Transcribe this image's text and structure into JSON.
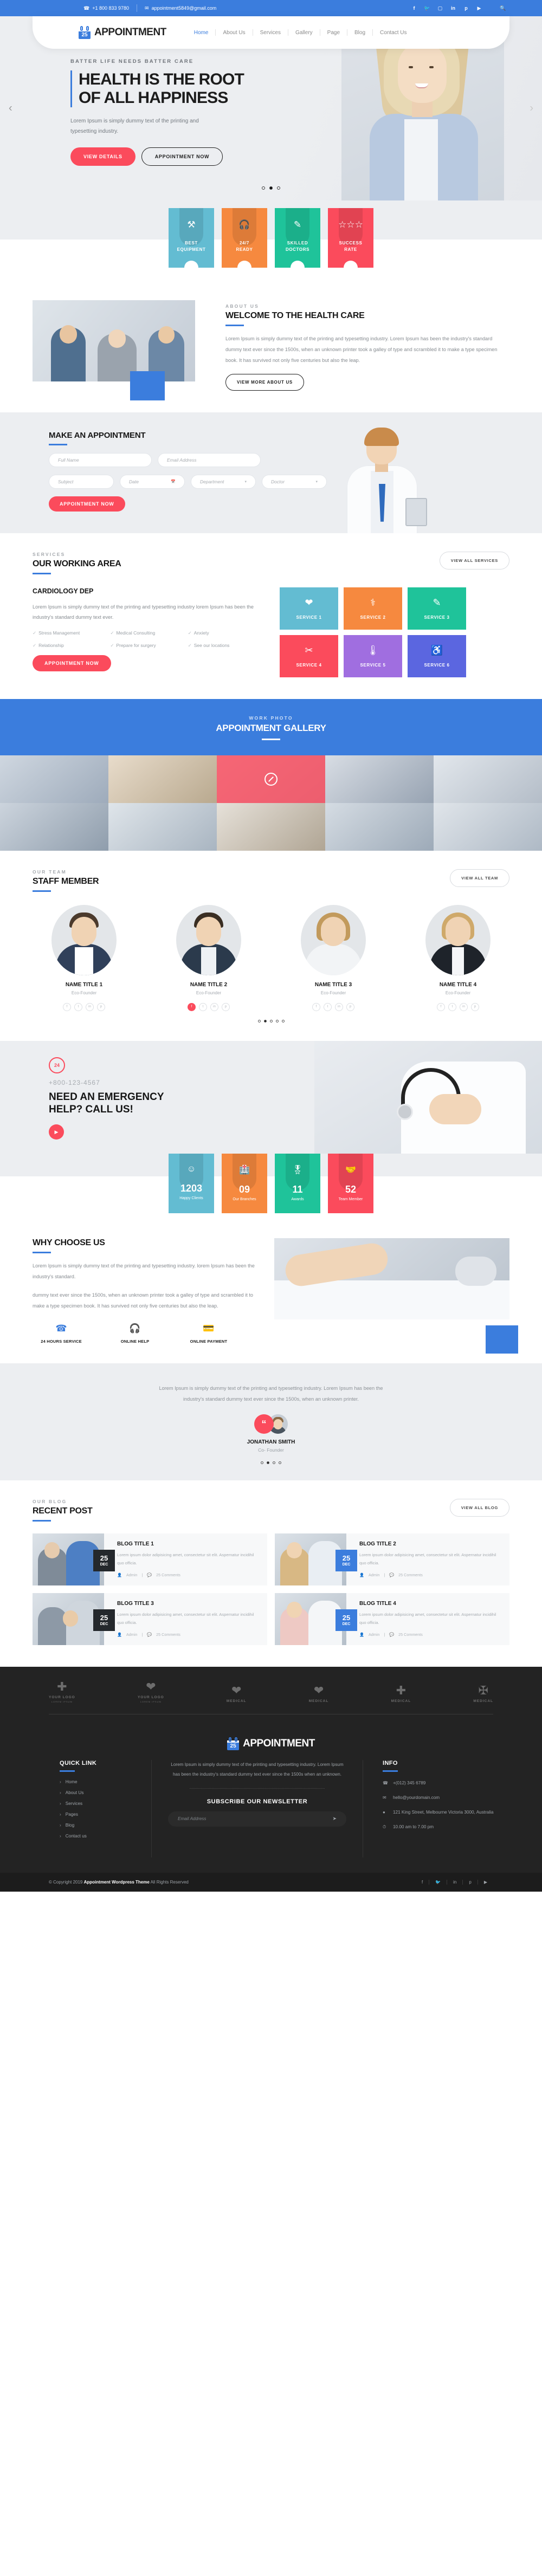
{
  "topbar": {
    "phone": "+1 800 833 9780",
    "email": "appointment5849@gmail.com",
    "phone_icon": "phone-icon",
    "email_icon": "envelope-icon",
    "socials": [
      "facebook-icon",
      "twitter-icon",
      "instagram-icon",
      "linkedin-icon",
      "pinterest-icon",
      "youtube-icon"
    ],
    "search_icon": "search-icon"
  },
  "header": {
    "logo_text": "APPOINTMENT",
    "logo_day": "25",
    "nav": [
      {
        "label": "Home",
        "active": true
      },
      {
        "label": "About Us",
        "active": false
      },
      {
        "label": "Services",
        "active": false
      },
      {
        "label": "Gallery",
        "active": false
      },
      {
        "label": "Page",
        "active": false
      },
      {
        "label": "Blog",
        "active": false
      },
      {
        "label": "Contact Us",
        "active": false
      }
    ]
  },
  "hero": {
    "supertitle": "BATTER LIFE NEEDS BATTER CARE",
    "title_line1": "HEALTH IS THE ROOT",
    "title_line2": "OF ALL HAPPINESS",
    "paragraph": "Lorem Ipsum is simply dummy text of the printing and typesetting industry.",
    "btn_primary": "VIEW DETAILS",
    "btn_secondary": "APPOINTMENT NOW",
    "prev_icon": "chevron-left-icon",
    "next_icon": "chevron-right-icon",
    "slide_count": 3,
    "active_slide": 2
  },
  "features": [
    {
      "icon": "tools-icon",
      "glyph": "⚒",
      "line1": "BEST",
      "line2": "EQUIPMENT",
      "color": "#63bcd2"
    },
    {
      "icon": "headset-icon",
      "glyph": "☎",
      "line1": "24/7",
      "line2": "READY",
      "color": "#f6893f"
    },
    {
      "icon": "syringe-icon",
      "glyph": "✐",
      "line1": "SKILLED",
      "line2": "DOCTORS",
      "color": "#1fc39a"
    },
    {
      "icon": "star-hand-icon",
      "glyph": "☆",
      "line1": "SUCCESS",
      "line2": "RATE",
      "color": "#fb4b5c"
    }
  ],
  "about": {
    "eyebrow": "ABOUT US",
    "title": "WELCOME TO THE HEALTH CARE",
    "paragraph": "Lorem Ipsum is simply dummy text of the printing and typesetting industry. Lorem Ipsum has been the industry's standard dummy text ever since the 1500s, when an unknown printer took a galley of type and scrambled it to make a type specimen book. It has survived not only five centuries but also the leap.",
    "button": "VIEW MORE ABOUT US"
  },
  "appointment": {
    "title": "MAKE AN APPOINTMENT",
    "fields": [
      {
        "name": "full-name",
        "placeholder": "Full Name",
        "type": "text"
      },
      {
        "name": "email-address",
        "placeholder": "Email Address",
        "type": "text"
      },
      {
        "name": "subject",
        "placeholder": "Subject",
        "type": "text"
      },
      {
        "name": "date",
        "placeholder": "Date",
        "type": "date",
        "icon": "calendar-icon"
      },
      {
        "name": "department",
        "placeholder": "Department",
        "type": "select"
      },
      {
        "name": "doctor",
        "placeholder": "Doctor",
        "type": "select"
      }
    ],
    "button": "APPOINTMENT NOW"
  },
  "services": {
    "eyebrow": "SERVICES",
    "title": "OUR WORKING AREA",
    "view_all": "VIEW ALL SERVICES",
    "dept_title": "CARDIOLOGY DEP",
    "dept_text": "Lorem Ipsum is simply dummy text of the printing and typesetting industry lorem Ipsum has been the industry's standard dummy text ever.",
    "checks": [
      "Stress Management",
      "Medical Consulting",
      "Anxiety",
      "Relationship",
      "Prepare for surgery",
      "See our locations"
    ],
    "button": "APPOINTMENT NOW",
    "tiles": [
      {
        "label": "SERVICE 1",
        "icon": "heart-organ-icon",
        "glyph": "❤",
        "color": "#63bcd2"
      },
      {
        "label": "SERVICE 2",
        "icon": "stethoscope-icon",
        "glyph": "⚕",
        "color": "#f6893f"
      },
      {
        "label": "SERVICE 3",
        "icon": "syringe-icon",
        "glyph": "✐",
        "color": "#1fc39a"
      },
      {
        "label": "SERVICE 4",
        "icon": "scalpel-icon",
        "glyph": "✒",
        "color": "#fb4b5c"
      },
      {
        "label": "SERVICE 5",
        "icon": "thermometer-icon",
        "glyph": "ᵀ",
        "color": "#a06ee0"
      },
      {
        "label": "SERVICE 6",
        "icon": "bone-joint-icon",
        "glyph": "⍠",
        "color": "#5b66e0"
      }
    ]
  },
  "gallery": {
    "eyebrow": "WORK PHOTO",
    "title": "APPOINTMENT GALLERY",
    "overlay_icon": "no-entry-icon",
    "cells": 10,
    "active_overlay_index": 2
  },
  "staff": {
    "eyebrow": "OUR TEAM",
    "title": "STAFF MEMBER",
    "view_all": "VIEW ALL TEAM",
    "members": [
      {
        "name": "NAME TITLE 1",
        "role": "Eco-Founder"
      },
      {
        "name": "NAME TITLE 2",
        "role": "Eco-Founder"
      },
      {
        "name": "NAME TITLE 3",
        "role": "Eco-Founder"
      },
      {
        "name": "NAME TITLE 4",
        "role": "Eco-Founder"
      }
    ],
    "socials_per_member": [
      "facebook-icon",
      "twitter-icon",
      "linkedin-icon",
      "pinterest-icon"
    ],
    "active_member_index": 1,
    "dots": 5,
    "active_dot": 1
  },
  "emergency": {
    "badge": "24",
    "badge_icon": "clock-24-icon",
    "phone": "+800-123-4567",
    "title_line1": "NEED AN EMERGENCY",
    "title_line2": "HELP? CALL US!",
    "play_icon": "play-icon"
  },
  "counters": [
    {
      "icon": "smiley-icon",
      "glyph": "☺",
      "value": "1203",
      "label": "Happy Clients",
      "color": "#63bcd2"
    },
    {
      "icon": "hospital-icon",
      "glyph": "⌂",
      "value": "09",
      "label": "Our Branches",
      "color": "#f6893f"
    },
    {
      "icon": "award-ribbon-icon",
      "glyph": "★",
      "value": "11",
      "label": "Awards",
      "color": "#1fc39a"
    },
    {
      "icon": "handshake-icon",
      "glyph": "✋",
      "value": "52",
      "label": "Team Member",
      "color": "#fb4b5c"
    }
  ],
  "why": {
    "title": "WHY CHOOSE US",
    "paragraph1": "Lorem Ipsum is simply dummy text of the printing and typesetting industry. lorem Ipsum has been the industry's standard.",
    "paragraph2": "dummy text ever since the 1500s, when an unknown printer took a galley of type and scrambled it to make a type specimen book. It has survived not only five centuries but also the leap.",
    "features": [
      {
        "icon": "24h-phone-icon",
        "glyph": "☎",
        "label": "24 HOURS SERVICE"
      },
      {
        "icon": "headset-icon",
        "glyph": "♫",
        "label": "ONLINE HELP"
      },
      {
        "icon": "credit-card-icon",
        "glyph": "▤",
        "label": "ONLINE PAYMENT"
      }
    ]
  },
  "testimonial": {
    "quote": "Lorem Ipsum is simply dummy text of the printing and typesetting industry. Lorem Ipsum has been the industry's standard dummy text ever since the 1500s, when an unknown printer.",
    "quote_icon": "quote-icon",
    "name": "JONATHAN SMITH",
    "role": "Co- Founder",
    "dots": 4,
    "active_dot": 1
  },
  "blog": {
    "eyebrow": "OUR BLOG",
    "title": "RECENT POST",
    "view_all": "VIEW ALL BLOG",
    "posts": [
      {
        "title": "BLOG TITLE 1",
        "excerpt": "Lorem ipsum dolor adipisicing amet, consectetur sit elit. Aspernatur incidihil quo officia.",
        "day": "25",
        "month": "DEC",
        "author": "Admin",
        "comments": "25 Comments",
        "date_style": "dark"
      },
      {
        "title": "BLOG TITLE 2",
        "excerpt": "Lorem ipsum dolor adipisicing amet, consectetur sit elit. Aspernatur incidihil quo officia.",
        "day": "25",
        "month": "DEC",
        "author": "Admin",
        "comments": "25 Comments",
        "date_style": "blue"
      },
      {
        "title": "BLOG TITLE 3",
        "excerpt": "Lorem ipsum dolor adipisicing amet, consectetur sit elit. Aspernatur incidihil quo officia.",
        "day": "25",
        "month": "DEC",
        "author": "Admin",
        "comments": "25 Comments",
        "date_style": "dark"
      },
      {
        "title": "BLOG TITLE 4",
        "excerpt": "Lorem ipsum dolor adipisicing amet, consectetur sit elit. Aspernatur incidihil quo officia.",
        "day": "25",
        "month": "DEC",
        "author": "Admin",
        "comments": "25 Comments",
        "date_style": "blue"
      }
    ],
    "author_icon": "user-icon",
    "comment_icon": "comment-icon"
  },
  "partners": [
    {
      "icon": "cross-bird-logo-icon",
      "glyph": "✚",
      "label": "YOUR LOGO",
      "sub": "LOREM IPSUM"
    },
    {
      "icon": "paw-heart-logo-icon",
      "glyph": "♥",
      "label": "YOUR LOGO",
      "sub": "LOREM IPSUM"
    },
    {
      "icon": "hand-heart-logo-icon",
      "glyph": "♥",
      "label": "MEDICAL",
      "sub": ""
    },
    {
      "icon": "heartbeat-logo-icon",
      "glyph": "♥",
      "label": "MEDICAL",
      "sub": ""
    },
    {
      "icon": "head-cross-logo-icon",
      "glyph": "✚",
      "label": "MEDICAL",
      "sub": ""
    },
    {
      "icon": "shield-cross-logo-icon",
      "glyph": "✠",
      "label": "MEDICAL",
      "sub": ""
    }
  ],
  "footer": {
    "logo_text": "APPOINTMENT",
    "logo_day": "25",
    "quick_link_title": "QUICK LINK",
    "quick_links": [
      "Home",
      "About Us",
      "Services",
      "Pages",
      "Blog",
      "Contact us"
    ],
    "description": "Lorem Ipsum is simply dummy text of the printing and typesetting industry. Lorem Ipsum has been the industry's standard dummy text ever since the 1500s when an unknown.",
    "newsletter_title": "SUBSCRIBE OUR NEWSLETTER",
    "newsletter_placeholder": "Email Address",
    "newsletter_icon": "send-icon",
    "info_title": "INFO",
    "info": [
      {
        "icon": "phone-icon",
        "text": "+(012) 345 6789"
      },
      {
        "icon": "envelope-icon",
        "text": "hello@yourdomain.com"
      },
      {
        "icon": "location-pin-icon",
        "text": "121 King Street, Melbourne Victoria 3000, Australia"
      },
      {
        "icon": "clock-icon",
        "text": "10.00 am to 7.00 pm"
      }
    ]
  },
  "copyright": {
    "prefix": "© Copyright 2019",
    "brand": "Appointment Wordpress Theme",
    "suffix": "All Rights Reserved",
    "socials": [
      "facebook-icon",
      "twitter-icon",
      "linkedin-icon",
      "pinterest-icon",
      "youtube-icon"
    ]
  },
  "colors": {
    "brand_blue": "#3b7ddd",
    "accent_red": "#fb4b5c",
    "teal": "#63bcd2",
    "orange": "#f6893f",
    "green": "#1fc39a",
    "purple": "#a06ee0",
    "indigo": "#5b66e0",
    "dark": "#232323"
  }
}
